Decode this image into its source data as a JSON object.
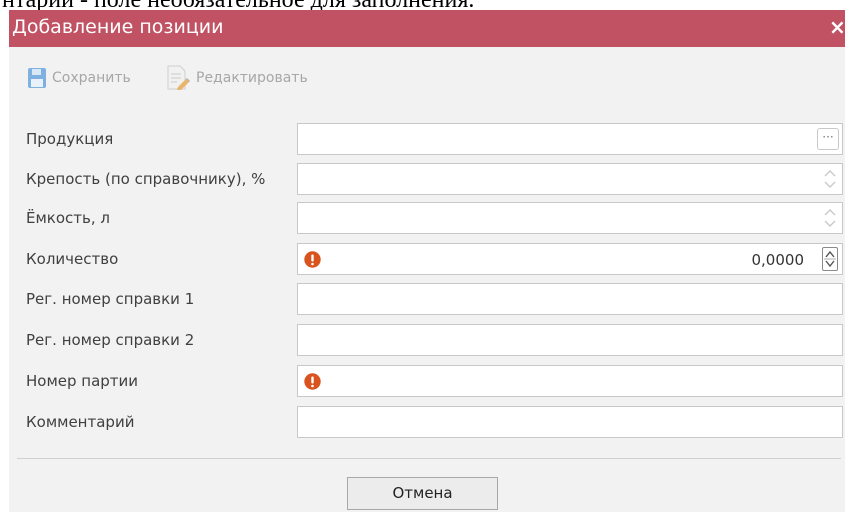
{
  "document_text": "нтарий - поле необязательное для заполнения.",
  "dialog": {
    "title": "Добавление позиции",
    "close_glyph": "×"
  },
  "toolbar": {
    "save_label": "Сохранить",
    "edit_label": "Редактировать"
  },
  "form": {
    "product_label": "Продукция",
    "product_picker": "···",
    "strength_label": "Крепость (по справочнику), %",
    "capacity_label": "Ёмкость, л",
    "quantity_label": "Количество",
    "quantity_value": "0,0000",
    "reg1_label": "Рег. номер справки 1",
    "reg2_label": "Рег. номер справки 2",
    "batch_label": "Номер партии",
    "comment_label": "Комментарий"
  },
  "footer": {
    "cancel_label": "Отмена"
  },
  "colors": {
    "titlebar": "#c05264",
    "warning": "#d9531e"
  }
}
